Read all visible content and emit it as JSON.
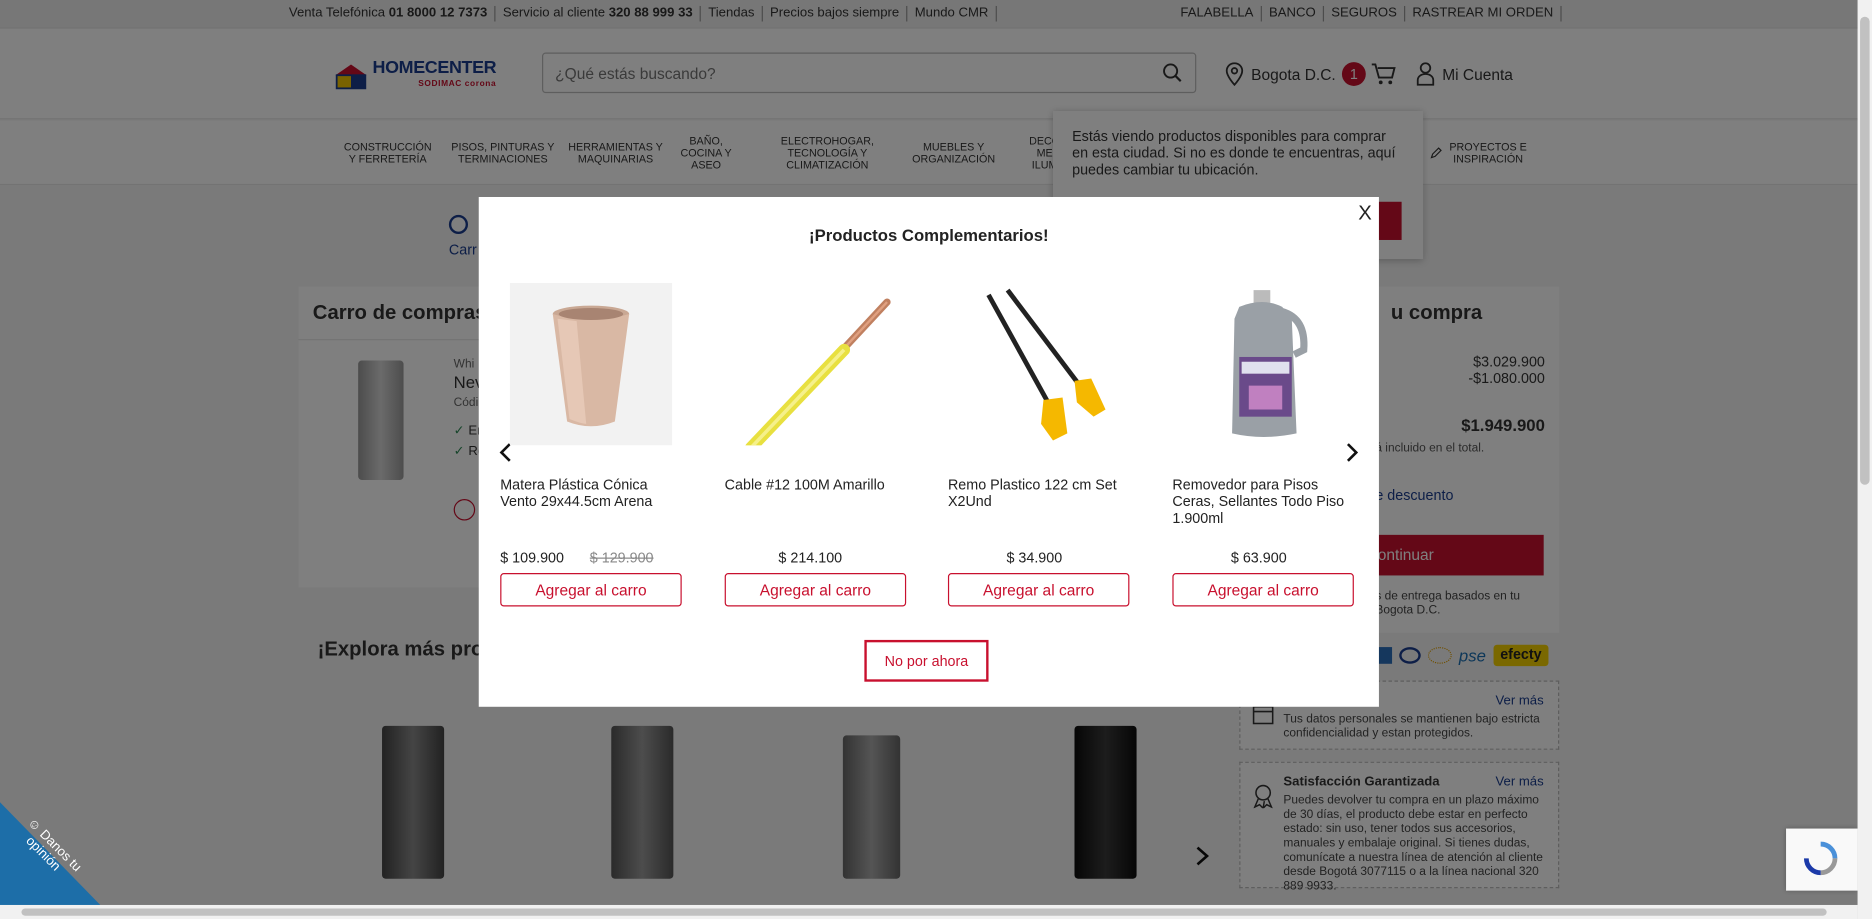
{
  "topbar": {
    "left": [
      {
        "prefix": "Venta Telefónica ",
        "strong": "01 8000 12 7373"
      },
      {
        "prefix": "Servicio al cliente ",
        "strong": "320 88 999 33"
      },
      {
        "prefix": "Tiendas",
        "strong": ""
      },
      {
        "prefix": "Precios bajos siempre",
        "strong": ""
      },
      {
        "prefix": "Mundo CMR",
        "strong": ""
      }
    ],
    "right": [
      "FALABELLA",
      "BANCO",
      "SEGUROS",
      "RASTREAR MI ORDEN"
    ]
  },
  "header": {
    "logo_text": "HOMECENTER",
    "logo_sub": "SODIMAC corona",
    "search_placeholder": "¿Qué estás buscando?",
    "location": "Bogota D.C.",
    "cart_count": "1",
    "account": "Mi Cuenta"
  },
  "nav": [
    {
      "l1": "CONSTRUCCIÓN",
      "l2": "Y FERRETERÍA",
      "l3": ""
    },
    {
      "l1": "PISOS, PINTURAS Y",
      "l2": "TERMINACIONES",
      "l3": ""
    },
    {
      "l1": "HERRAMIENTAS Y",
      "l2": "MAQUINARIAS",
      "l3": ""
    },
    {
      "l1": "BAÑO,",
      "l2": "COCINA Y",
      "l3": "ASEO"
    },
    {
      "l1": "ELECTROHOGAR,",
      "l2": "TECNOLOGÍA Y",
      "l3": "CLIMATIZACIÓN"
    },
    {
      "l1": "MUEBLES Y",
      "l2": "ORGANIZACIÓN",
      "l3": ""
    },
    {
      "l1": "DECO",
      "l2": "ME",
      "l3": "ILUM"
    },
    {
      "l1": "PROYECTOS E",
      "l2": "INSPIRACIÓN",
      "l3": ""
    }
  ],
  "tooltip": {
    "text": "Estás viendo productos disponibles para comprar en esta ciudad. Si no es donde te encuentras, aquí puedes cambiar tu ubicación."
  },
  "steps": {
    "first_label": "Carr"
  },
  "cart": {
    "title": "Carro de compras",
    "item_brand": "Whi",
    "item_name": "Nev",
    "item_code": "Códi",
    "check1": "En",
    "check2": "Re"
  },
  "summary": {
    "title": "u compra",
    "subtotal": "$3.029.900",
    "discount": "-$1.080.000",
    "total": "$1.949.900",
    "tax_note": "á incluido en el total.",
    "coupon": "e descuento",
    "continue": "ontinuar",
    "delivery_note_1": "s de entrega basados en tu",
    "delivery_note_2": "Bogota D.C."
  },
  "explore": {
    "title": "¡Explora más prod"
  },
  "trust": [
    {
      "title": "",
      "more": "Ver más",
      "desc": "Tus datos personales se mantienen bajo estricta confidencialidad y estan protegidos."
    },
    {
      "title": "Satisfacción Garantizada",
      "more": "Ver más",
      "desc": "Puedes devolver tu compra en un plazo máximo de 30 días, el producto debe estar en perfecto estado: sin uso, tener todos sus accesorios, manuales y embalaje original. Si tienes dudas, comunícate a nuestra línea de atención al cliente desde Bogotá 3077115 o a la línea nacional 320 889 9933."
    }
  ],
  "modal": {
    "close": "X",
    "title": "¡Productos Complementarios!",
    "skip": "No por ahora",
    "products": [
      {
        "name": "Matera Plástica Cónica Vento 29x44.5cm Arena",
        "price": "$ 109.900",
        "old_price": "$ 129.900",
        "add": "Agregar al carro"
      },
      {
        "name": "Cable #12 100M Amarillo",
        "price": "$ 214.100",
        "old_price": "",
        "add": "Agregar al carro"
      },
      {
        "name": "Remo Plastico 122 cm Set X2Und",
        "price": "$ 34.900",
        "old_price": "",
        "add": "Agregar al carro"
      },
      {
        "name": "Removedor para Pisos Ceras, Sellantes Todo Piso 1.900ml",
        "price": "$ 63.900",
        "old_price": "",
        "add": "Agregar al carro"
      }
    ]
  },
  "feedback": {
    "line1": "Danos tu",
    "line2": "opinión"
  },
  "payments": {
    "pse": "pse",
    "efecty": "efecty"
  },
  "colors": {
    "brand_red": "#c8102e",
    "brand_blue": "#1a3d8f"
  }
}
